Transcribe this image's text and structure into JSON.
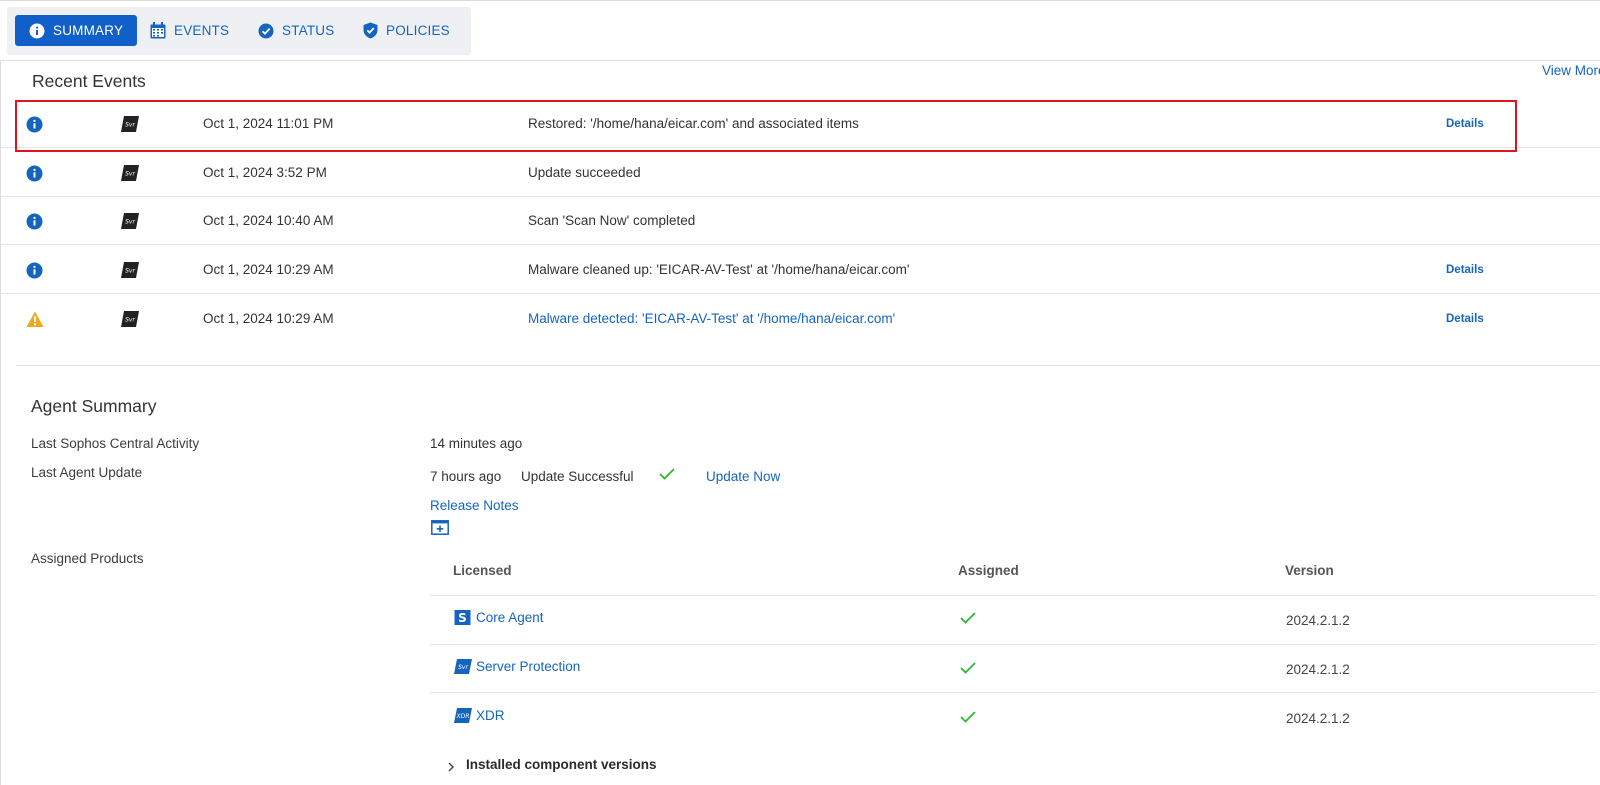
{
  "tabs": [
    {
      "label": "SUMMARY",
      "icon": "info-icon",
      "active": true
    },
    {
      "label": "EVENTS",
      "icon": "calendar-icon",
      "active": false
    },
    {
      "label": "STATUS",
      "icon": "check-circle-icon",
      "active": false
    },
    {
      "label": "POLICIES",
      "icon": "shield-check-icon",
      "active": false
    }
  ],
  "recent_events": {
    "title": "Recent Events",
    "view_more": "View More",
    "rows": [
      {
        "severity": "info",
        "product_icon": "svr",
        "date": "Oct 1, 2024 11:01 PM",
        "description": "Restored: '/home/hana/eicar.com' and associated items",
        "details": "Details",
        "highlighted": true
      },
      {
        "severity": "info",
        "product_icon": "svr",
        "date": "Oct 1, 2024 3:52 PM",
        "description": "Update succeeded",
        "details": ""
      },
      {
        "severity": "info",
        "product_icon": "svr",
        "date": "Oct 1, 2024 10:40 AM",
        "description": "Scan 'Scan Now' completed",
        "details": ""
      },
      {
        "severity": "info",
        "product_icon": "svr",
        "date": "Oct 1, 2024 10:29 AM",
        "description": "Malware cleaned up: 'EICAR-AV-Test' at '/home/hana/eicar.com'",
        "details": "Details"
      },
      {
        "severity": "warning",
        "product_icon": "svr",
        "date": "Oct 1, 2024 10:29 AM",
        "description": "Malware detected: 'EICAR-AV-Test' at '/home/hana/eicar.com'",
        "details": "Details",
        "description_is_link": true
      }
    ]
  },
  "agent_summary": {
    "title": "Agent Summary",
    "last_central_activity_label": "Last Sophos Central Activity",
    "last_central_activity_value": "14 minutes ago",
    "last_agent_update_label": "Last Agent Update",
    "last_agent_update_value": "7 hours ago",
    "update_status": "Update Successful",
    "update_now": "Update Now",
    "release_notes": "Release Notes",
    "assigned_products_label": "Assigned Products"
  },
  "products_table": {
    "headers": {
      "licensed": "Licensed",
      "assigned": "Assigned",
      "version": "Version"
    },
    "rows": [
      {
        "name": "Core Agent",
        "icon": "sophos-s-icon",
        "assigned": true,
        "version": "2024.2.1.2"
      },
      {
        "name": "Server Protection",
        "icon": "svr-icon",
        "assigned": true,
        "version": "2024.2.1.2"
      },
      {
        "name": "XDR",
        "icon": "xdr-icon",
        "assigned": true,
        "version": "2024.2.1.2"
      }
    ],
    "installed_components": "Installed component versions"
  },
  "colors": {
    "accent": "#1160c9",
    "link": "#1565c0",
    "success": "#2eb82e",
    "warning": "#f0a81e",
    "highlight_border": "#e0141e"
  }
}
